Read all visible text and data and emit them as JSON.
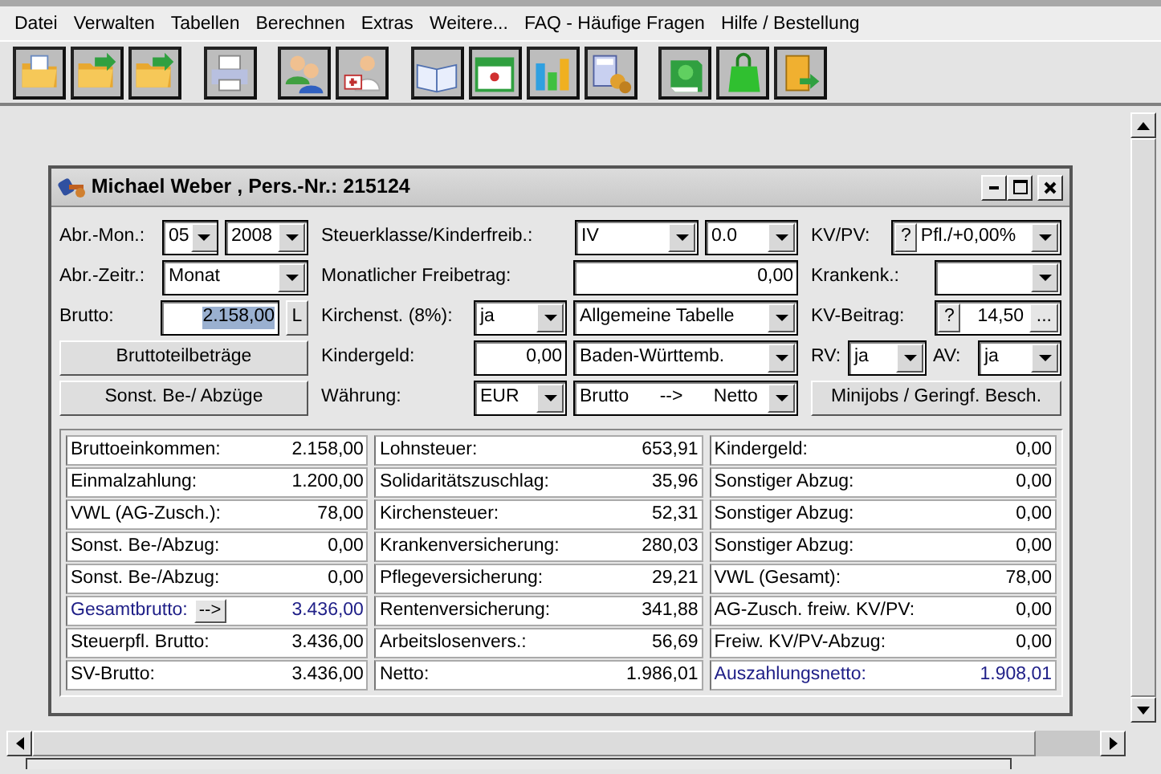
{
  "menu": [
    "Datei",
    "Verwalten",
    "Tabellen",
    "Berechnen",
    "Extras",
    "Weitere...",
    "FAQ - Häufige Fragen",
    "Hilfe / Bestellung"
  ],
  "window": {
    "title": "Michael Weber , Pers.-Nr.: 215124"
  },
  "form": {
    "sections": [
      {
        "fields": [
          {
            "label": "Abr.-Mon.:",
            "controls": [
              {
                "kind": "combo",
                "value": "05"
              },
              {
                "kind": "combo",
                "value": "2008"
              }
            ]
          },
          {
            "label": "Abr.-Zeitr.:",
            "controls": [
              {
                "kind": "combo",
                "value": "Monat"
              }
            ]
          },
          {
            "label": "Brutto:",
            "controls": [
              {
                "kind": "input",
                "value": "2.158,00",
                "selected": true
              },
              {
                "kind": "button",
                "text": "L"
              }
            ]
          },
          {
            "controls": [
              {
                "kind": "button",
                "text": "Bruttoteilbeträge"
              }
            ]
          },
          {
            "controls": [
              {
                "kind": "button",
                "text": "Sonst. Be-/ Abzüge"
              }
            ]
          }
        ]
      },
      {
        "fields": [
          {
            "label": "Steuerklasse/Kinderfreib.:",
            "controls": [
              {
                "kind": "combo",
                "value": "IV"
              },
              {
                "kind": "combo",
                "value": "0.0"
              }
            ]
          },
          {
            "label": "Monatlicher Freibetrag:",
            "controls": [
              {
                "kind": "input",
                "value": "0,00",
                "selected": false
              }
            ]
          },
          {
            "label": "Kirchenst. (8%):",
            "controls": [
              {
                "kind": "combo",
                "value": "ja"
              },
              {
                "kind": "combo",
                "value": "Allgemeine Tabelle"
              }
            ]
          },
          {
            "label": "Kindergeld:",
            "controls": [
              {
                "kind": "input",
                "value": "0,00",
                "selected": false
              },
              {
                "kind": "combo",
                "value": "Baden-Württemb."
              }
            ]
          },
          {
            "label": "Währung:",
            "controls": [
              {
                "kind": "combo",
                "value": "EUR"
              },
              {
                "kind": "combo",
                "value": "Brutto      -->      Netto"
              }
            ]
          }
        ]
      },
      {
        "fields": [
          {
            "label": "KV/PV:",
            "controls": [
              {
                "kind": "help-combo",
                "help": "?",
                "value": "Pfl./+0,00%"
              }
            ]
          },
          {
            "label": "Krankenk.:",
            "controls": [
              {
                "kind": "combo"
              }
            ]
          },
          {
            "label": "KV-Beitrag:",
            "controls": [
              {
                "kind": "help-input",
                "help": "?",
                "value": "14,50",
                "more": "..."
              }
            ]
          },
          {
            "label": "RV:",
            "controls": [
              {
                "kind": "combo",
                "value": "ja"
              },
              {
                "kind": "label",
                "text": "AV:"
              },
              {
                "kind": "combo",
                "value": "ja"
              }
            ]
          },
          {
            "controls": [
              {
                "kind": "button",
                "text": "Minijobs / Geringf. Besch."
              }
            ]
          }
        ]
      }
    ]
  },
  "results": [
    [
      {
        "label": "Bruttoeinkommen:",
        "value": "2.158,00",
        "emphasis": false
      },
      {
        "label": "Einmalzahlung:",
        "value": "1.200,00",
        "emphasis": false
      },
      {
        "label": "VWL (AG-Zusch.):",
        "value": "78,00",
        "emphasis": false
      },
      {
        "label": "Sonst. Be-/Abzug:",
        "value": "0,00",
        "emphasis": false
      },
      {
        "label": "Sonst. Be-/Abzug:",
        "value": "0,00",
        "emphasis": false
      },
      {
        "label": "Gesamtbrutto:",
        "button": "-->",
        "value": "3.436,00",
        "emphasis": true
      },
      {
        "label": "Steuerpfl. Brutto:",
        "value": "3.436,00",
        "emphasis": false
      },
      {
        "label": "SV-Brutto:",
        "value": "3.436,00",
        "emphasis": false
      }
    ],
    [
      {
        "label": "Lohnsteuer:",
        "value": "653,91",
        "emphasis": false
      },
      {
        "label": "Solidaritätszuschlag:",
        "value": "35,96",
        "emphasis": false
      },
      {
        "label": "Kirchensteuer:",
        "value": "52,31",
        "emphasis": false
      },
      {
        "label": "Krankenversicherung:",
        "value": "280,03",
        "emphasis": false
      },
      {
        "label": "Pflegeversicherung:",
        "value": "29,21",
        "emphasis": false
      },
      {
        "label": "Rentenversicherung:",
        "value": "341,88",
        "emphasis": false
      },
      {
        "label": "Arbeitslosenvers.:",
        "value": "56,69",
        "emphasis": false
      },
      {
        "label": "Netto:",
        "value": "1.986,01",
        "emphasis": false
      }
    ],
    [
      {
        "label": "Kindergeld:",
        "value": "0,00",
        "emphasis": false
      },
      {
        "label": "Sonstiger Abzug:",
        "value": "0,00",
        "emphasis": false
      },
      {
        "label": "Sonstiger Abzug:",
        "value": "0,00",
        "emphasis": false
      },
      {
        "label": "Sonstiger Abzug:",
        "value": "0,00",
        "emphasis": false
      },
      {
        "label": "VWL (Gesamt):",
        "value": "78,00",
        "emphasis": false
      },
      {
        "label": "AG-Zusch. freiw. KV/PV:",
        "value": "0,00",
        "emphasis": false
      },
      {
        "label": "Freiw. KV/PV-Abzug:",
        "value": "0,00",
        "emphasis": false
      },
      {
        "label": "Auszahlungsnetto:",
        "value": "1.908,01",
        "emphasis": true
      }
    ]
  ]
}
